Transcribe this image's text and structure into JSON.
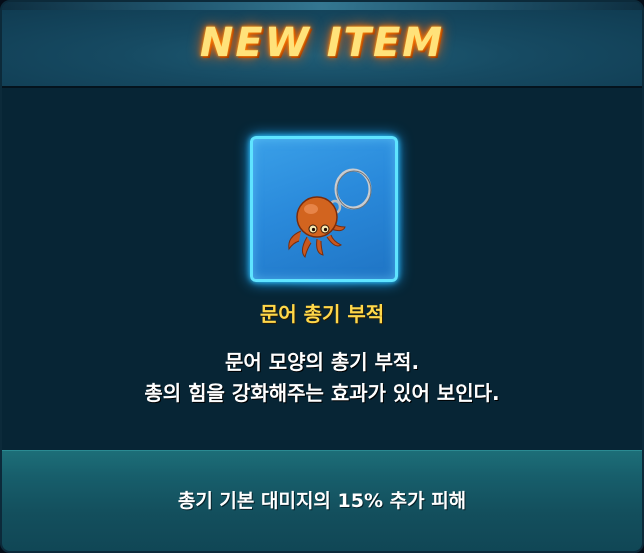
{
  "popup": {
    "title": "NEW ITEM"
  },
  "item": {
    "icon": "octopus-keychain-icon",
    "name": "문어 총기 부적",
    "description": [
      "문어 모양의 총기 부적.",
      "총의 힘을 강화해주는 효과가 있어 보인다."
    ],
    "effect": "총기 기본 대미지의 15% 추가 피해"
  },
  "colors": {
    "title": "#ffe27a",
    "title_glow": "#ff7a00",
    "item_name": "#ffd84a",
    "slot_border": "#5fe4ff",
    "slot_fill": "#2a8adb",
    "panel": "#072535",
    "effect_bar": "#175e6b"
  }
}
